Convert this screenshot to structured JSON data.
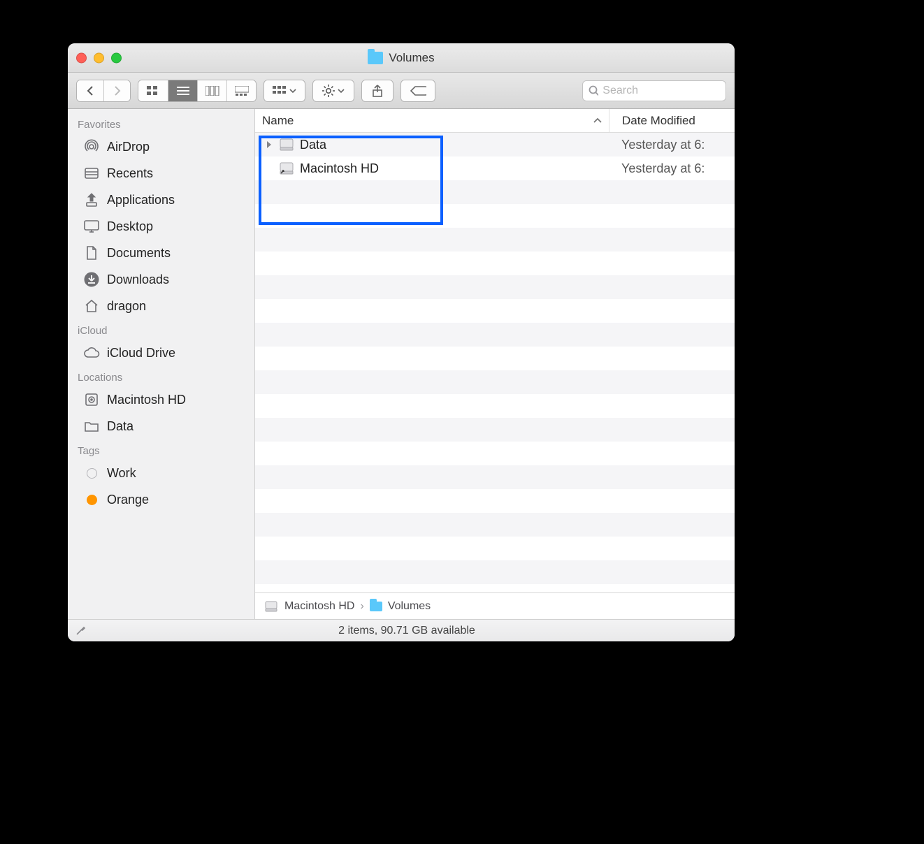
{
  "window": {
    "title": "Volumes"
  },
  "toolbar": {
    "search_placeholder": "Search"
  },
  "sidebar": {
    "favorites_heading": "Favorites",
    "favorites": [
      {
        "label": "AirDrop"
      },
      {
        "label": "Recents"
      },
      {
        "label": "Applications"
      },
      {
        "label": "Desktop"
      },
      {
        "label": "Documents"
      },
      {
        "label": "Downloads"
      },
      {
        "label": "dragon"
      }
    ],
    "icloud_heading": "iCloud",
    "icloud": [
      {
        "label": "iCloud Drive"
      }
    ],
    "locations_heading": "Locations",
    "locations": [
      {
        "label": "Macintosh HD"
      },
      {
        "label": "Data"
      }
    ],
    "tags_heading": "Tags",
    "tags": [
      {
        "label": "Work"
      },
      {
        "label": "Orange"
      }
    ]
  },
  "columns": {
    "name": "Name",
    "date": "Date Modified"
  },
  "items": [
    {
      "name": "Data",
      "date": "Yesterday at 6:",
      "expandable": true
    },
    {
      "name": "Macintosh HD",
      "date": "Yesterday at 6:",
      "expandable": false
    }
  ],
  "path": {
    "seg0": "Macintosh HD",
    "seg1": "Volumes"
  },
  "status": {
    "text": "2 items, 90.71 GB available"
  }
}
